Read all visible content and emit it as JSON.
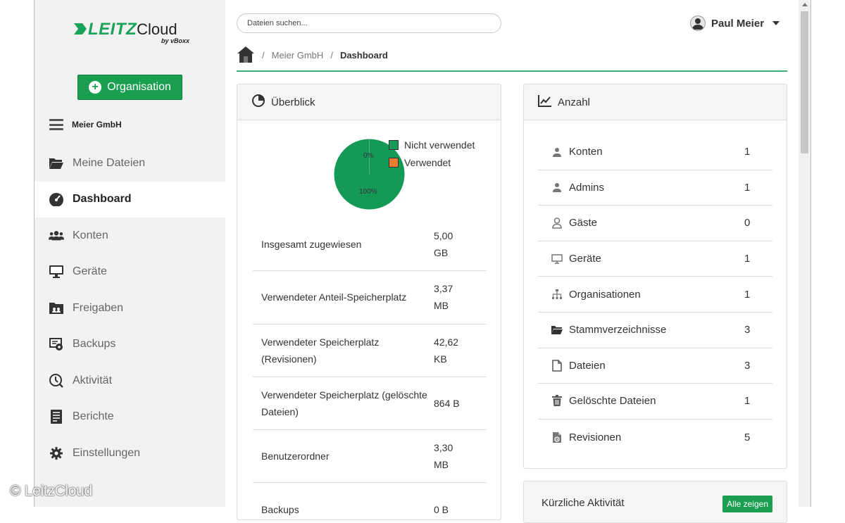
{
  "logo": {
    "brand": "LEITZ",
    "product": "Cloud",
    "byline": "by vBoxx"
  },
  "sidebar": {
    "org_button": "Organisation",
    "org_name": "Meier GmbH",
    "items": [
      {
        "label": "Meine Dateien",
        "icon": "folder-open-icon"
      },
      {
        "label": "Dashboard",
        "icon": "tachometer-icon"
      },
      {
        "label": "Konten",
        "icon": "users-icon"
      },
      {
        "label": "Geräte",
        "icon": "monitor-icon"
      },
      {
        "label": "Freigaben",
        "icon": "share-icon"
      },
      {
        "label": "Backups",
        "icon": "backup-icon"
      },
      {
        "label": "Aktivität",
        "icon": "activity-icon"
      },
      {
        "label": "Berichte",
        "icon": "report-icon"
      },
      {
        "label": "Einstellungen",
        "icon": "gear-icon"
      }
    ]
  },
  "header": {
    "search_placeholder": "Dateien suchen...",
    "user_name": "Paul Meier"
  },
  "breadcrumb": {
    "org": "Meier GmbH",
    "current": "Dashboard",
    "separator": "/"
  },
  "overview": {
    "title": "Überblick",
    "legend": [
      {
        "label": "Nicht verwendet",
        "color": "#159957"
      },
      {
        "label": "Verwendet",
        "color": "#f07c34"
      }
    ],
    "pie_labels": {
      "unused": "100%",
      "used": "0%"
    },
    "rows": [
      {
        "label": "Insgesamt zugewiesen",
        "value": "5,00 GB"
      },
      {
        "label": "Verwendeter Anteil-Speicherplatz",
        "value": "3,37 MB"
      },
      {
        "label": "Verwendeter Speicherplatz (Revisionen)",
        "value": "42,62 KB"
      },
      {
        "label": "Verwendeter Speicherplatz (gelöschte Dateien)",
        "value": "864 B"
      },
      {
        "label": "Benutzerordner",
        "value": "3,30 MB"
      },
      {
        "label": "Backups",
        "value": "0 B"
      }
    ]
  },
  "count": {
    "title": "Anzahl",
    "rows": [
      {
        "label": "Konten",
        "value": "1",
        "icon": "user-icon"
      },
      {
        "label": "Admins",
        "value": "1",
        "icon": "user-icon"
      },
      {
        "label": "Gäste",
        "value": "0",
        "icon": "user-outline-icon"
      },
      {
        "label": "Geräte",
        "value": "1",
        "icon": "monitor-icon"
      },
      {
        "label": "Organisationen",
        "value": "1",
        "icon": "sitemap-icon"
      },
      {
        "label": "Stammverzeichnisse",
        "value": "3",
        "icon": "folder-open-icon"
      },
      {
        "label": "Dateien",
        "value": "3",
        "icon": "file-icon"
      },
      {
        "label": "Gelöschte Dateien",
        "value": "1",
        "icon": "trash-icon"
      },
      {
        "label": "Revisionen",
        "value": "5",
        "icon": "file-revision-icon"
      }
    ]
  },
  "recent": {
    "title": "Kürzliche Aktivität",
    "show_all": "Alle zeigen"
  },
  "watermark": "© LeitzCloud",
  "colors": {
    "accent": "#1a9e50",
    "rule": "#3cb07a",
    "used": "#f07c34",
    "unused": "#159957"
  }
}
